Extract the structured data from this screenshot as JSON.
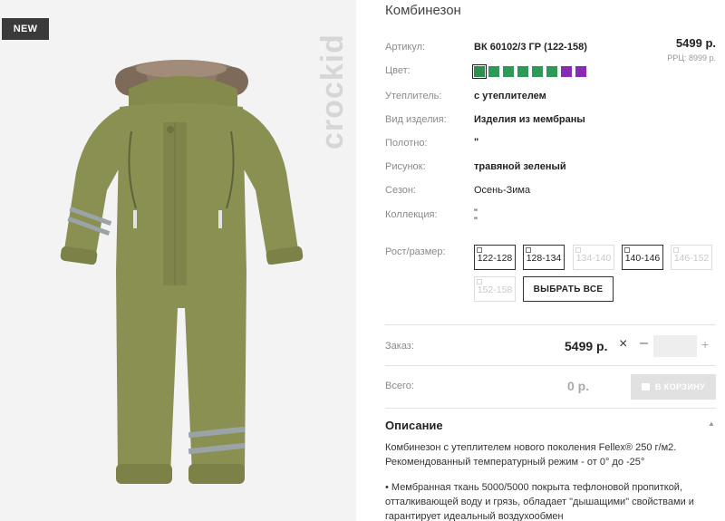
{
  "badge": "NEW",
  "brand": "crockid",
  "product": {
    "title": "Комбинезон",
    "price": "5499 р.",
    "rrp": "РРЦ: 8999 р."
  },
  "attributes": {
    "article": {
      "label": "Артикул:",
      "value": "ВК 60102/3 ГР (122-158)"
    },
    "color": {
      "label": "Цвет:"
    },
    "insulation": {
      "label": "Утеплитель:",
      "value": "с утеплителем"
    },
    "kind": {
      "label": "Вид изделия:",
      "value": "Изделия из мембраны"
    },
    "fabric": {
      "label": "Полотно:",
      "value": "\""
    },
    "pattern": {
      "label": "Рисунок:",
      "value": "травяной зеленый"
    },
    "season": {
      "label": "Сезон:",
      "value": "Осень-Зима"
    },
    "collection": {
      "label": "Коллекция:",
      "value1": "\"",
      "value2": "\""
    },
    "size": {
      "label": "Рост/размер:"
    }
  },
  "swatches": [
    {
      "color": "#2f8f4f",
      "selected": true
    },
    {
      "color": "#2f9a55",
      "selected": false
    },
    {
      "color": "#2f9a55",
      "selected": false
    },
    {
      "color": "#2f9a55",
      "selected": false
    },
    {
      "color": "#2f9a55",
      "selected": false
    },
    {
      "color": "#2f9a55",
      "selected": false
    },
    {
      "color": "#8a2bb8",
      "selected": false
    },
    {
      "color": "#8a2bb8",
      "selected": false
    }
  ],
  "sizes": [
    {
      "label": "122-128",
      "available": true
    },
    {
      "label": "128-134",
      "available": true
    },
    {
      "label": "134-140",
      "available": false
    },
    {
      "label": "140-146",
      "available": true
    },
    {
      "label": "146-152",
      "available": false
    },
    {
      "label": "152-158",
      "available": false
    }
  ],
  "select_all_label": "ВЫБРАТЬ ВСЕ",
  "order": {
    "label": "Заказ:",
    "price": "5499 р.",
    "remove_icon": "×",
    "minus": "–",
    "plus": "+",
    "quantity": ""
  },
  "total": {
    "label": "Всего:",
    "value": "0 р.",
    "cart_label": "В КОРЗИНУ"
  },
  "description": {
    "title": "Описание",
    "line1": "Комбинезон с утеплителем нового поколения Fellex® 250 г/м2.",
    "line2": "Рекомендованный температурный режим - от 0° до -25°",
    "line3": "• Мембранная ткань 5000/5000 покрыта тефлоновой пропиткой,",
    "line4": "отталкивающей воду и грязь, обладает \"дышащими\" свойствами и",
    "line5": "гарантирует идеальный воздухообмен"
  },
  "colors": {
    "garment": "#8a8f52",
    "garment_dark": "#737842",
    "reflective": "#9aa3a5",
    "fur": "#8a7563"
  }
}
